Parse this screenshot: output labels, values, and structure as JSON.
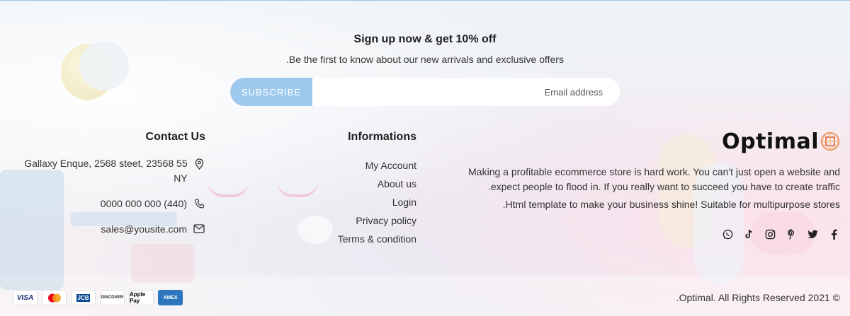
{
  "newsletter": {
    "title": "Sign up now & get 10% off",
    "subtitle": ".Be the first to know about our new arrivals and exclusive offers",
    "button_label": "SUBSCRIBE",
    "email_placeholder": "Email address"
  },
  "contact": {
    "heading": "Contact Us",
    "address": "Gallaxy Enque, 2568 steet, 23568 55 NY",
    "phone": "0000 000 000 (440)",
    "email": "sales@yousite.com"
  },
  "informations": {
    "heading": "Informations",
    "links": [
      "My Account",
      "About us",
      "Login",
      "Privacy policy",
      "Terms & condition"
    ]
  },
  "about": {
    "logo": "Optimal",
    "text1": "Making a profitable ecommerce store is hard work. You can't just open a website and .expect people to flood in. If you really want to succeed you have to create traffic",
    "text2": ".Html template to make your business shine! Suitable for multipurpose stores",
    "social_icons": [
      "whatsapp-icon",
      "tiktok-icon",
      "instagram-icon",
      "pinterest-icon",
      "twitter-icon",
      "facebook-icon"
    ]
  },
  "payments": [
    "VISA",
    "mastercard",
    "JCB",
    "DISCOVER",
    "Apple Pay",
    "AMEX"
  ],
  "copyright": ".Optimal. All Rights Reserved 2021 ©",
  "colors": {
    "accent": "#9ec9ee",
    "text": "#333333",
    "heading": "#1f1f1f"
  }
}
